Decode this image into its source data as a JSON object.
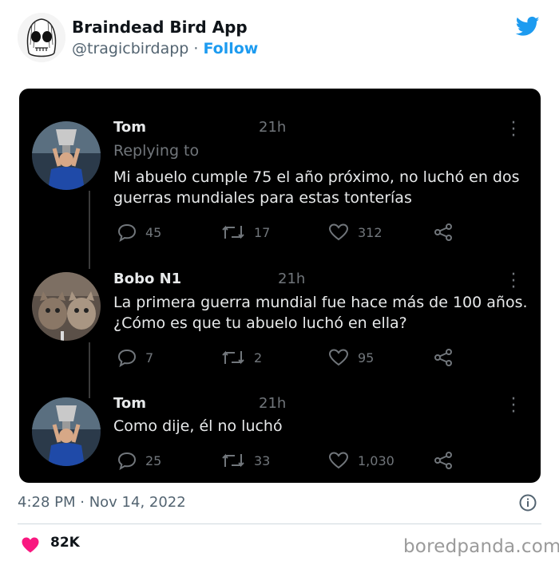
{
  "header": {
    "author_name": "Braindead Bird App",
    "author_handle": "@tragicbirdapp",
    "separator": " · ",
    "follow_label": "Follow",
    "logo_icon": "twitter-bird-icon",
    "accent_color": "#1d9bf0"
  },
  "thread": [
    {
      "name": "Tom",
      "time": "21h",
      "replying": "Replying to",
      "text": "Mi abuelo cumple 75 el año próximo, no luchó en dos guerras mundiales para estas tonterías",
      "replies": "45",
      "retweets": "17",
      "likes": "312"
    },
    {
      "name": "Bobo N1",
      "time": "21h",
      "text": "La primera guerra mundial fue hace más de 100 años. ¿Cómo es que tu abuelo luchó en ella?",
      "replies": "7",
      "retweets": "2",
      "likes": "95"
    },
    {
      "name": "Tom",
      "time": "21h",
      "text": "Como dije, él no luchó",
      "replies": "25",
      "retweets": "33",
      "likes": "1,030"
    }
  ],
  "footer": {
    "timestamp": "4:28 PM · Nov 14, 2022",
    "like_count": "82K",
    "like_color": "#f91880",
    "watermark": "boredpanda.com"
  }
}
